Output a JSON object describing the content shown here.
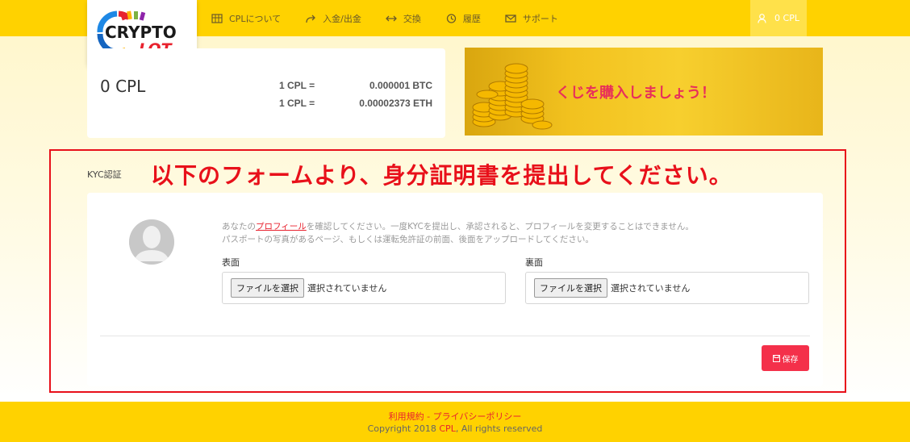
{
  "logo": {
    "line1": "CRYPTO",
    "line2": "LOT"
  },
  "nav": {
    "items": [
      {
        "label": "CPLについて",
        "icon": "table-icon"
      },
      {
        "label": "入金/出金",
        "icon": "forward-arrow-icon"
      },
      {
        "label": "交換",
        "icon": "exchange-arrows-icon"
      },
      {
        "label": "履歴",
        "icon": "history-icon"
      },
      {
        "label": "サポート",
        "icon": "mail-icon"
      }
    ],
    "user_balance": "0 CPL"
  },
  "balance": {
    "amount": "0 CPL",
    "rates": [
      {
        "left": "1 CPL =",
        "right": "0.000001 BTC"
      },
      {
        "left": "1 CPL =",
        "right": "0.00002373 ETH"
      }
    ]
  },
  "banner": {
    "text": "くじを購入しましょう！"
  },
  "kyc": {
    "section_label": "KYC認証",
    "instruction": "以下のフォームより、身分証明書を提出してください。",
    "desc_prefix": "あなたの",
    "desc_link": "プロフィール",
    "desc_suffix": "を確認してください。一度KYCを提出し、承認されると、プロフィールを変更することはできません。",
    "desc_line2": "パスポートの写真があるページ、もしくは運転免許証の前面、後面をアップロードしてください。",
    "front_label": "表面",
    "back_label": "裏面",
    "file_button": "ファイルを選択",
    "no_file": "選択されていません",
    "save_label": "保存"
  },
  "footer": {
    "links": "利用規約 - プライバシーポリシー",
    "copy_prefix": "Copyright 2018 ",
    "copy_brand": "CPL",
    "copy_suffix": ", All rights reserved"
  },
  "colors": {
    "brand_yellow": "#ffd200",
    "accent_red": "#e8222e",
    "save_button": "#f4304a"
  }
}
